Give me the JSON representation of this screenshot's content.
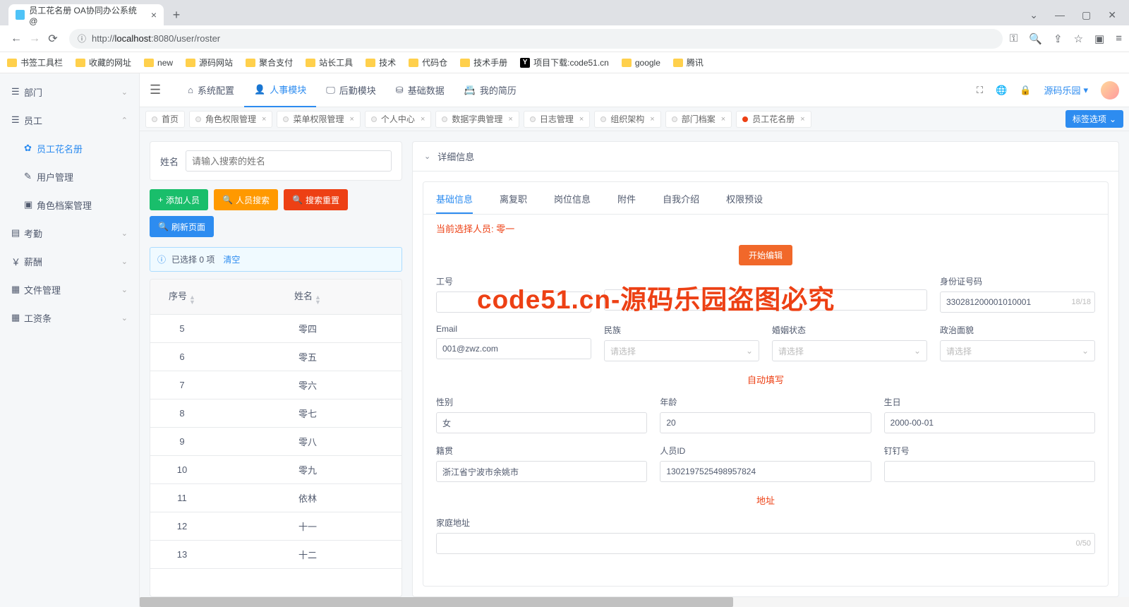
{
  "browser": {
    "tab_title": "员工花名册 OA协同办公系统 @",
    "url_prefix": "http://",
    "url_host": "localhost",
    "url_rest": ":8080/user/roster",
    "info_icon": "ⓘ"
  },
  "bookmarks": [
    "书签工具栏",
    "收藏的网址",
    "new",
    "源码网站",
    "聚合支付",
    "站长工具",
    "技术",
    "代码仓",
    "技术手册"
  ],
  "bookmark_special": {
    "label": "项目下载:code51.cn",
    "icon": "Y"
  },
  "bookmarks_tail": [
    "google",
    "腾讯"
  ],
  "sidebar": {
    "dept": "部门",
    "emp": "员工",
    "sub": [
      {
        "icon": "✿",
        "label": "员工花名册",
        "active": true
      },
      {
        "icon": "✎",
        "label": "用户管理"
      },
      {
        "icon": "▣",
        "label": "角色档案管理"
      }
    ],
    "rest": [
      {
        "icon": "▤",
        "label": "考勤"
      },
      {
        "icon": "￥",
        "label": "薪酬"
      },
      {
        "icon": "▦",
        "label": "文件管理"
      },
      {
        "icon": "▦",
        "label": "工资条"
      }
    ]
  },
  "topnav": {
    "items": [
      {
        "icon": "⌂",
        "label": "系统配置"
      },
      {
        "icon": "👤",
        "label": "人事模块",
        "active": true
      },
      {
        "icon": "🖵",
        "label": "后勤模块"
      },
      {
        "icon": "⛁",
        "label": "基础数据"
      },
      {
        "icon": "📇",
        "label": "我的简历"
      }
    ],
    "user": "源码乐园"
  },
  "pagetabs": [
    "首页",
    "角色权限管理",
    "菜单权限管理",
    "个人中心",
    "数据字典管理",
    "日志管理",
    "组织架构",
    "部门档案",
    "员工花名册"
  ],
  "tabopt_label": "标签选项",
  "left": {
    "name_label": "姓名",
    "search_ph": "请输入搜索的姓名",
    "btn_add": "添加人员",
    "btn_search": "人员搜索",
    "btn_reset": "搜索重置",
    "btn_refresh": "刷新页面",
    "alert_text": "已选择 0 项",
    "alert_clear": "清空",
    "col_idx": "序号",
    "col_name": "姓名",
    "rows": [
      {
        "idx": "5",
        "name": "零四"
      },
      {
        "idx": "6",
        "name": "零五"
      },
      {
        "idx": "7",
        "name": "零六"
      },
      {
        "idx": "8",
        "name": "零七"
      },
      {
        "idx": "9",
        "name": "零八"
      },
      {
        "idx": "10",
        "name": "零九"
      },
      {
        "idx": "11",
        "name": "依林"
      },
      {
        "idx": "12",
        "name": "十一"
      },
      {
        "idx": "13",
        "name": "十二"
      }
    ]
  },
  "right": {
    "detail_title": "详细信息",
    "tabs": [
      "基础信息",
      "离复职",
      "岗位信息",
      "附件",
      "自我介绍",
      "权限预设"
    ],
    "current_prefix": "当前选择人员: ",
    "current_name": "零一",
    "edit_btn": "开始编辑",
    "labels": {
      "gonghao": "工号",
      "idcard": "身份证号码",
      "email": "Email",
      "minzu": "民族",
      "hunyin": "婚姻状态",
      "zhengzhi": "政治面貌",
      "sel_ph": "请选择",
      "auto_fill": "自动填写",
      "sex": "性别",
      "age": "年龄",
      "birth": "生日",
      "jiguan": "籍贯",
      "renyuanid": "人员ID",
      "dingding": "钉钉号",
      "addr_div": "地址",
      "home_addr": "家庭地址"
    },
    "vals": {
      "idcard": "330281200001010001",
      "idcard_count": "18/18",
      "email": "001@zwz.com",
      "sex": "女",
      "age": "20",
      "birth": "2000-00-01",
      "jiguan": "浙江省宁波市余姚市",
      "renyuanid": "1302197525498957824",
      "addr_count": "0/50"
    }
  },
  "watermark": "code51.cn-源码乐园盗图必究"
}
